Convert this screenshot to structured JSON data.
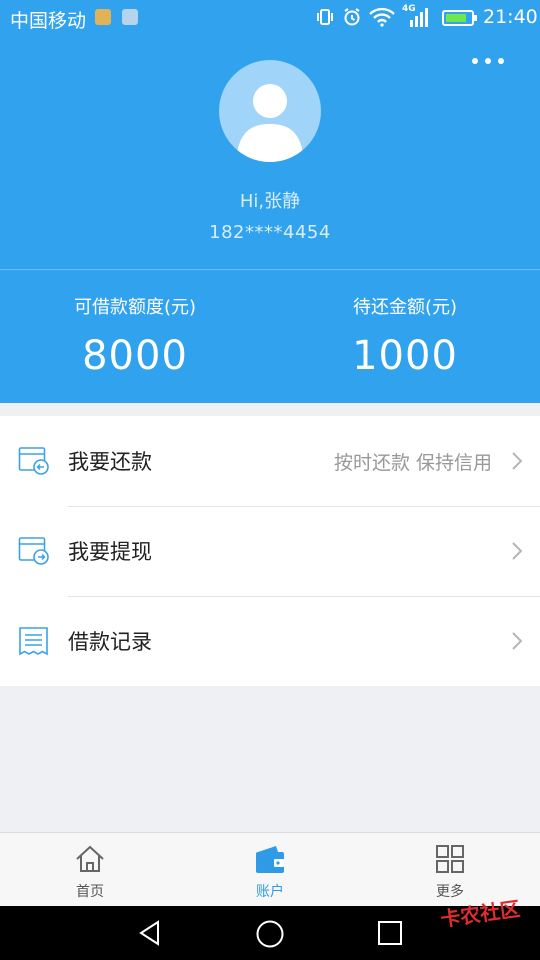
{
  "status_bar": {
    "carrier": "中国移动",
    "time": "21:40",
    "network_badge": "4G",
    "icons": [
      "lock-icon",
      "image-icon",
      "vibrate-icon",
      "alarm-icon",
      "wifi-icon",
      "signal-icon",
      "battery-charging-icon"
    ]
  },
  "profile": {
    "greeting": "Hi,张静",
    "phone": "182****4454"
  },
  "stats": {
    "credit_label": "可借款额度(元)",
    "credit_value": "8000",
    "due_label": "待还金额(元)",
    "due_value": "1000"
  },
  "menu": {
    "items": [
      {
        "label": "我要还款",
        "hint": "按时还款 保持信用",
        "icon": "repay-card-icon"
      },
      {
        "label": "我要提现",
        "hint": "",
        "icon": "withdraw-card-icon"
      },
      {
        "label": "借款记录",
        "hint": "",
        "icon": "receipt-icon"
      }
    ]
  },
  "tabs": [
    {
      "label": "首页",
      "icon": "home-icon"
    },
    {
      "label": "账户",
      "icon": "wallet-icon",
      "active": true
    },
    {
      "label": "更多",
      "icon": "grid-icon"
    }
  ],
  "watermark": "卡农社区",
  "colors": {
    "primary": "#31a2ed",
    "active_tab": "#2f9be6",
    "background": "#eff0f4"
  }
}
